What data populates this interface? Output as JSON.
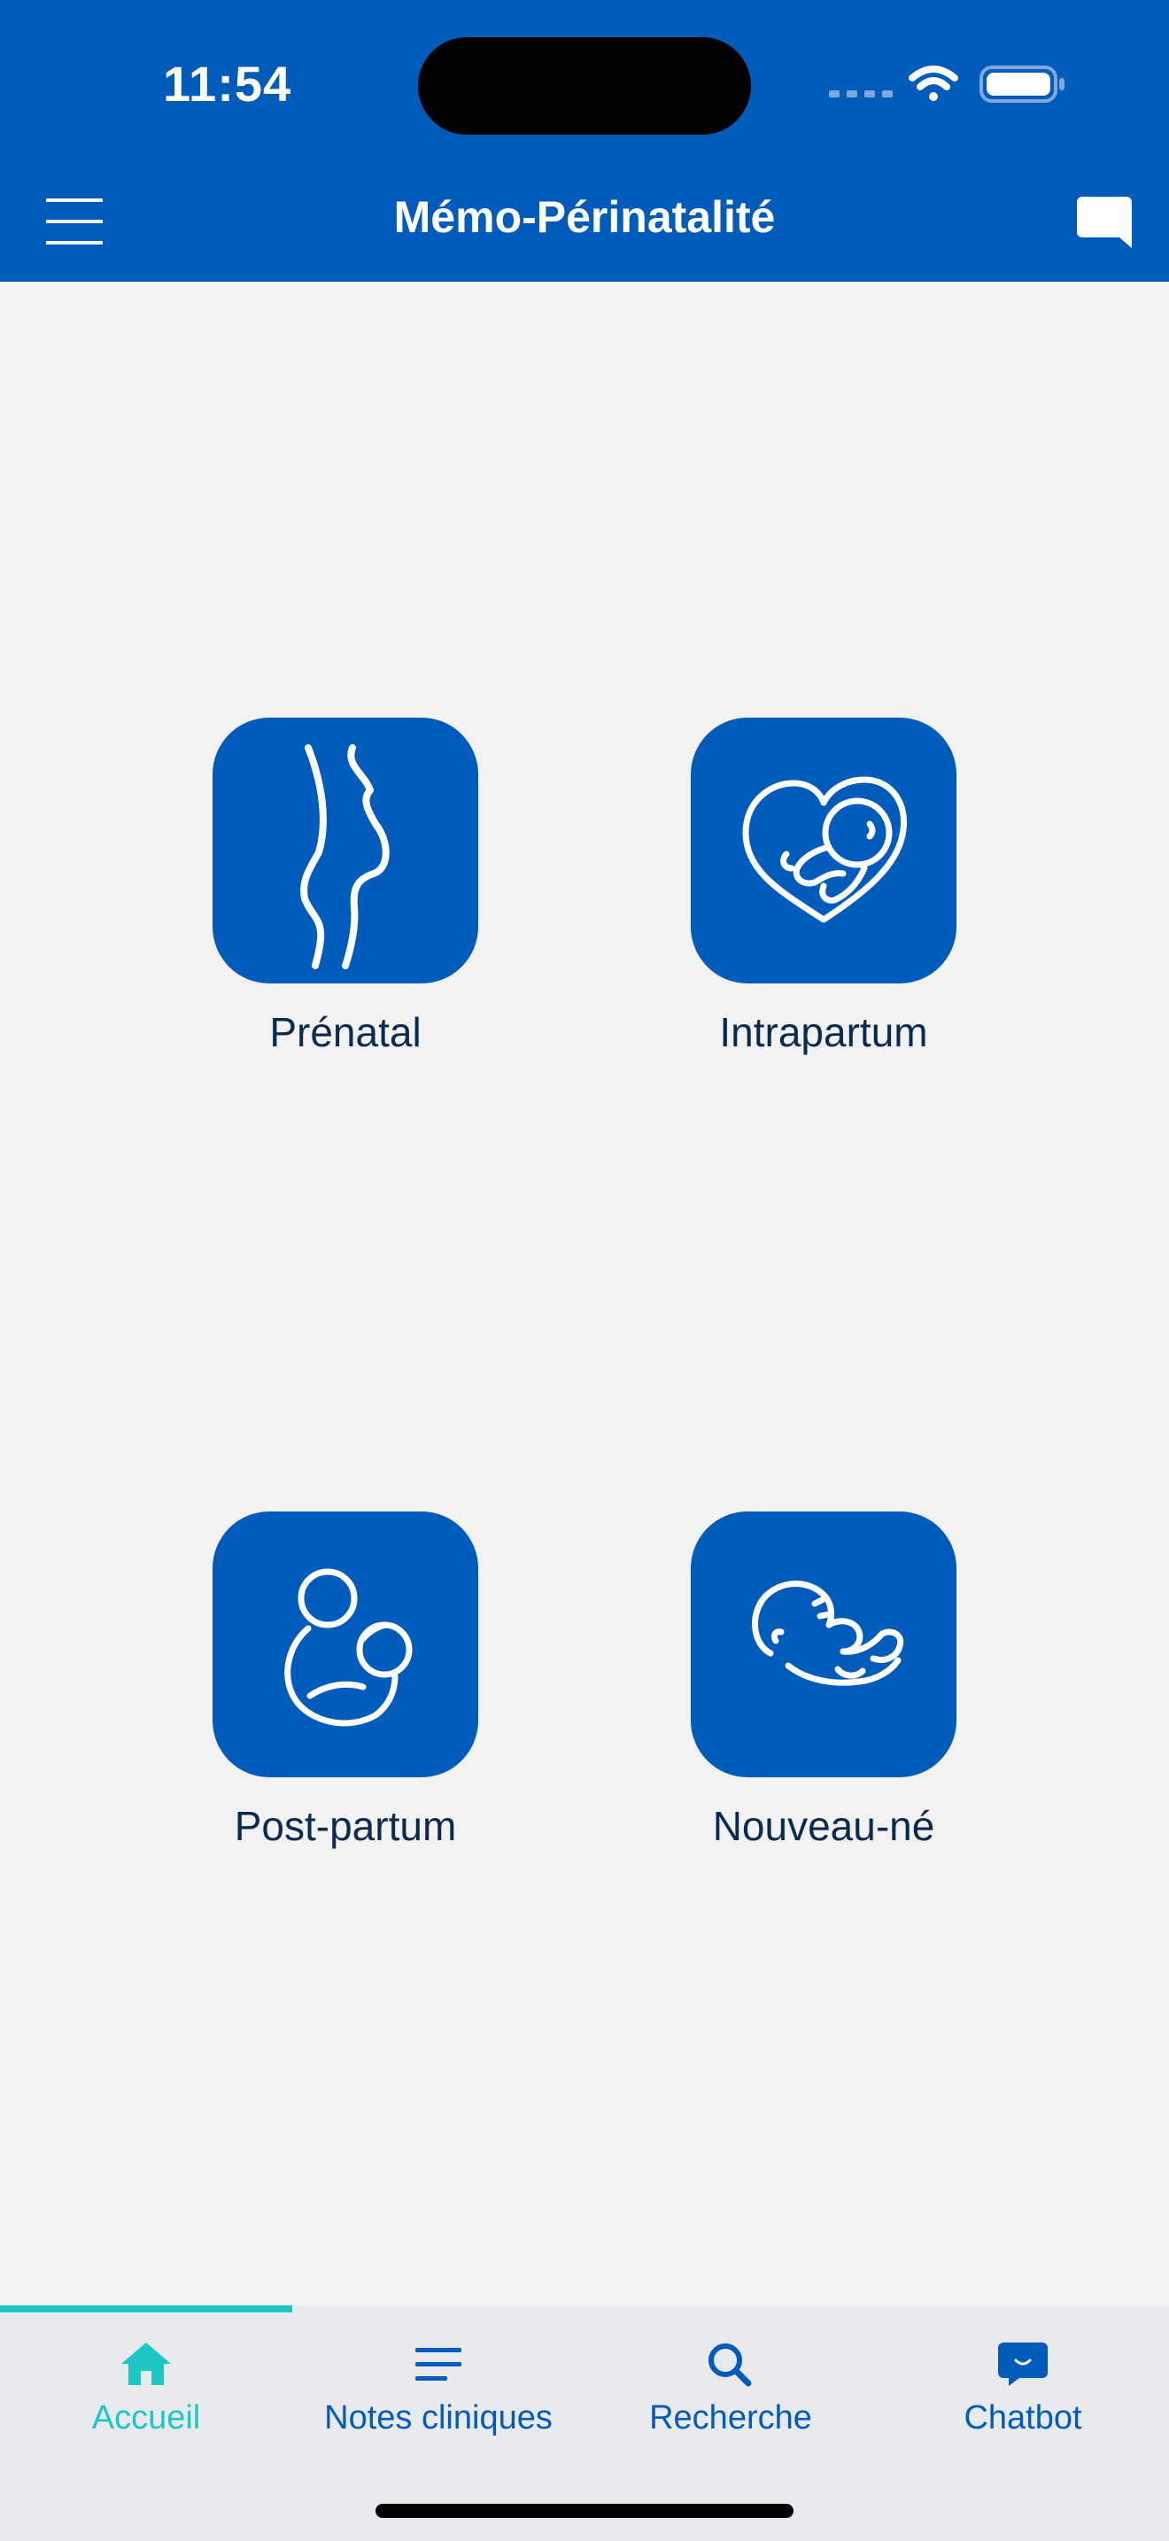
{
  "status_bar": {
    "time": "11:54"
  },
  "header": {
    "title": "Mémo-Périnatalité"
  },
  "tiles": [
    {
      "label": "Prénatal",
      "icon": "pregnant-silhouette-icon"
    },
    {
      "label": "Intrapartum",
      "icon": "fetus-in-heart-icon"
    },
    {
      "label": "Post-partum",
      "icon": "mother-holding-baby-icon"
    },
    {
      "label": "Nouveau-né",
      "icon": "newborn-icon"
    }
  ],
  "tabbar": {
    "active_index": 0,
    "tabs": [
      {
        "label": "Accueil",
        "icon": "home-icon"
      },
      {
        "label": "Notes cliniques",
        "icon": "notes-lines-icon"
      },
      {
        "label": "Recherche",
        "icon": "search-icon"
      },
      {
        "label": "Chatbot",
        "icon": "chat-bubble-icon"
      }
    ]
  },
  "colors": {
    "primary": "#005bbb",
    "accent": "#1ec6c6",
    "background": "#f2f2f3",
    "tabbar_background": "#e8eaee",
    "tile_label": "#0b2a4f"
  }
}
